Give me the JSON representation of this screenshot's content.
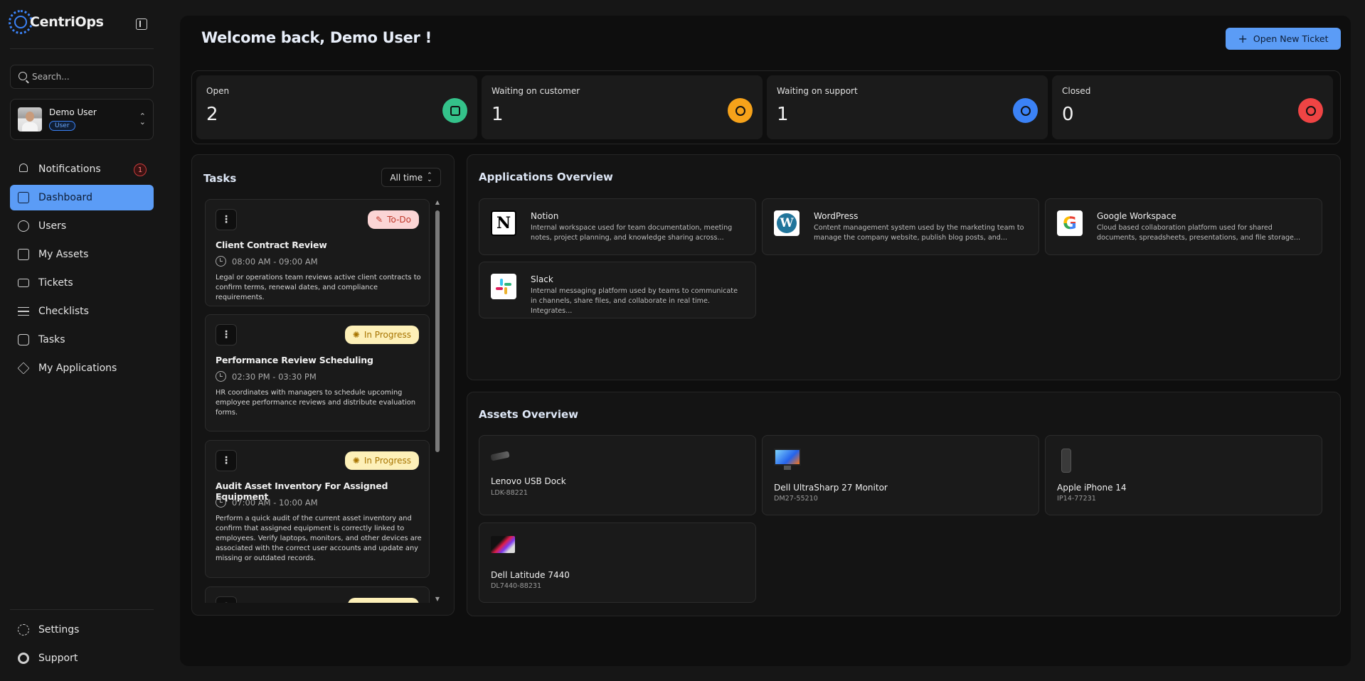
{
  "app": {
    "name": "CentriOps"
  },
  "search": {
    "placeholder": "Search..."
  },
  "user": {
    "name": "Demo User",
    "role": "User"
  },
  "nav": {
    "items": [
      {
        "label": "Notifications",
        "icon": "bell-icon",
        "badge": "1"
      },
      {
        "label": "Dashboard",
        "icon": "dashboard-icon",
        "active": true
      },
      {
        "label": "Users",
        "icon": "users-icon"
      },
      {
        "label": "My Assets",
        "icon": "box-icon"
      },
      {
        "label": "Tickets",
        "icon": "ticket-icon"
      },
      {
        "label": "Checklists",
        "icon": "checklist-icon"
      },
      {
        "label": "Tasks",
        "icon": "checkbox-icon"
      },
      {
        "label": "My Applications",
        "icon": "layers-icon"
      }
    ],
    "bottom": [
      {
        "label": "Settings",
        "icon": "gear-icon"
      },
      {
        "label": "Support",
        "icon": "lifebuoy-icon"
      }
    ]
  },
  "header": {
    "welcome": "Welcome back, Demo User !",
    "new_ticket": "Open New Ticket"
  },
  "stats": [
    {
      "label": "Open",
      "value": "2",
      "color": "#34c28a",
      "icon": "ticket-icon"
    },
    {
      "label": "Waiting on customer",
      "value": "1",
      "color": "#f6a21a",
      "icon": "link-icon"
    },
    {
      "label": "Waiting on support",
      "value": "1",
      "color": "#3b82f6",
      "icon": "clock-icon"
    },
    {
      "label": "Closed",
      "value": "0",
      "color": "#ef4444",
      "icon": "x-circle-icon"
    }
  ],
  "tasks": {
    "title": "Tasks",
    "filter": "All time",
    "items": [
      {
        "status": "To-Do",
        "title": "Client Contract Review",
        "time": "08:00 AM - 09:00 AM",
        "description": "Legal or operations team reviews active client contracts to confirm terms, renewal dates, and compliance requirements."
      },
      {
        "status": "In Progress",
        "title": "Performance Review Scheduling",
        "time": "02:30 PM - 03:30 PM",
        "description": "HR coordinates with managers to schedule upcoming employee performance reviews and distribute evaluation forms."
      },
      {
        "status": "In Progress",
        "title": "Audit Asset Inventory For Assigned Equipment",
        "time": "07:00 AM - 10:00 AM",
        "description": "Perform a quick audit of the current asset inventory and confirm that assigned equipment is correctly linked to employees. Verify laptops, monitors, and other devices are associated with the correct user accounts and update any missing or outdated records."
      }
    ]
  },
  "applications": {
    "title": "Applications Overview",
    "items": [
      {
        "name": "Notion",
        "description": "Internal workspace used for team documentation, meeting notes, project planning, and knowledge sharing across...",
        "logo": "notion-logo"
      },
      {
        "name": "WordPress",
        "description": "Content management system used by the marketing team to manage the company website, publish blog posts, and...",
        "logo": "wordpress-logo"
      },
      {
        "name": "Google Workspace",
        "description": "Cloud based collaboration platform used for shared documents, spreadsheets, presentations, and file storage...",
        "logo": "google-logo"
      },
      {
        "name": "Slack",
        "description": "Internal messaging platform used by teams to communicate in channels, share files, and collaborate in real time. Integrates...",
        "logo": "slack-logo"
      }
    ]
  },
  "assets": {
    "title": "Assets Overview",
    "items": [
      {
        "name": "Lenovo USB Dock",
        "code": "LDK-88221"
      },
      {
        "name": "Dell UltraSharp 27 Monitor",
        "code": "DM27-55210"
      },
      {
        "name": "Apple iPhone 14",
        "code": "IP14-77231"
      },
      {
        "name": "Dell Latitude 7440",
        "code": "DL7440-88231"
      }
    ]
  }
}
